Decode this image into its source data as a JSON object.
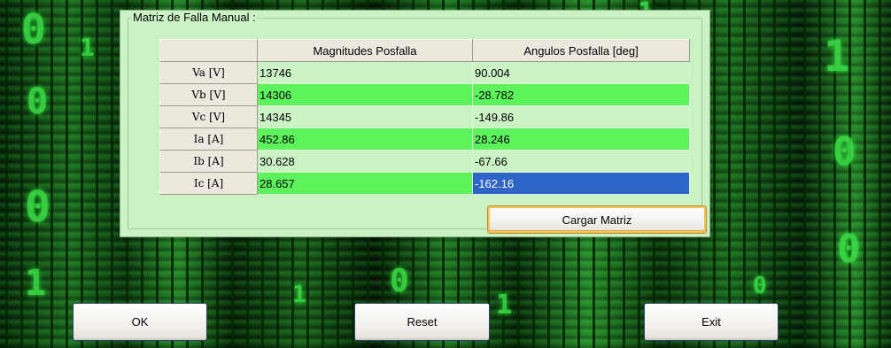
{
  "panel": {
    "title": "Matriz de Falla Manual :"
  },
  "grid": {
    "columns": [
      "",
      "Magnitudes Posfalla",
      "Angulos Posfalla [deg]"
    ],
    "rows": [
      {
        "label": "Va [V]",
        "magnitude": "13746",
        "angle": "90.004"
      },
      {
        "label": "Vb [V]",
        "magnitude": "14306",
        "angle": "-28.782"
      },
      {
        "label": "Vc [V]",
        "magnitude": "14345",
        "angle": "-149.86"
      },
      {
        "label": "Ia [A]",
        "magnitude": "452.86",
        "angle": "28.246"
      },
      {
        "label": "Ib [A]",
        "magnitude": "30.628",
        "angle": "-67.66"
      },
      {
        "label": "Ic [A]",
        "magnitude": "28.657",
        "angle": "-162.16"
      }
    ],
    "selected_cell": {
      "row": 5,
      "column": "angle"
    }
  },
  "buttons": {
    "load_matrix": "Cargar Matriz",
    "ok": "OK",
    "reset": "Reset",
    "exit": "Exit"
  },
  "colors": {
    "panel_bg": "#cbf2c5",
    "row_highlight": "#5cf45a",
    "selection": "#2f64c9",
    "background_theme": "green-matrix"
  }
}
